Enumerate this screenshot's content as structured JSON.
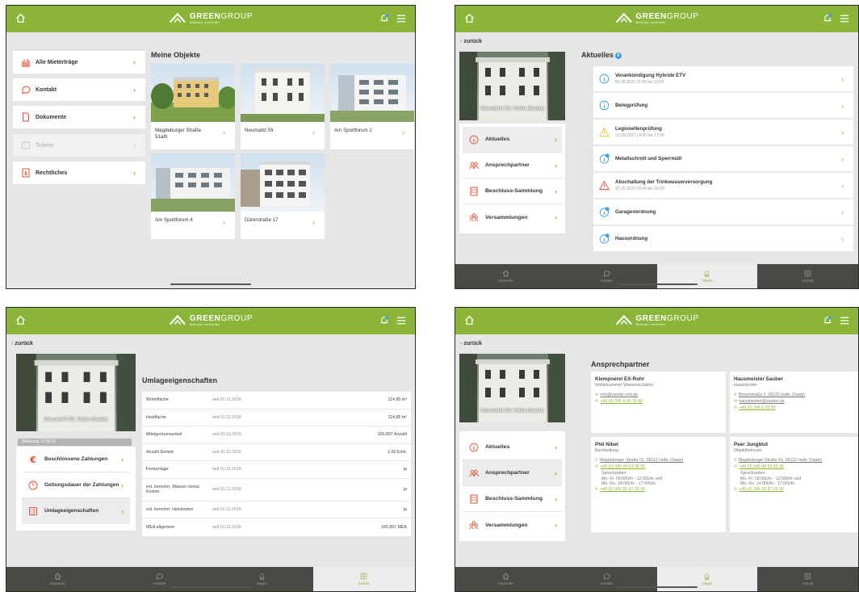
{
  "common": {
    "brand_bold": "GREEN",
    "brand_light": "GROUP",
    "brand_sub": "Wohnen verbindet",
    "back_label": "zurück",
    "location_caption": "Neumarkt 59, Halle (Saale)",
    "tabs": [
      "Startseite",
      "Kontakt",
      "Objekt",
      "Einheit"
    ]
  },
  "screen1": {
    "nav": [
      {
        "label": "Alle Mieterträge",
        "disabled": false
      },
      {
        "label": "Kontakt",
        "disabled": false
      },
      {
        "label": "Dokumente",
        "disabled": false
      },
      {
        "label": "Tickets",
        "disabled": true
      },
      {
        "label": "Rechtliches",
        "disabled": false
      }
    ],
    "objects_title": "Meine Objekte",
    "objects": [
      "Magdeburger Straße 51a/b",
      "Neumarkt 59",
      "Am Sportforum 2",
      "Am Sportforum 4",
      "Dürerstraße 17"
    ]
  },
  "screen2": {
    "news_title": "Aktuelles",
    "news_count": "6",
    "menu": [
      "Aktuelles",
      "Ansprechpartner",
      "Beschluss-Sammlung",
      "Versammlungen"
    ],
    "news": [
      {
        "title": "Vorankündigung Hybride ETV",
        "date": "06.08.2022 11:00 bis 13:00",
        "icon": "info-icon"
      },
      {
        "title": "Belegprüfung",
        "date": "",
        "icon": "info-icon"
      },
      {
        "title": "Legionellenprüfung",
        "date": "21.03.2022 14:00 bis 17:00",
        "icon": "warning-icon"
      },
      {
        "title": "Metallschrott und Sperrmüll",
        "date": "",
        "icon": "info-badge-icon"
      },
      {
        "title": "Abschaltung der Trinkwasserversorgung",
        "date": "15.02.2022 09:00 bis 16:00",
        "icon": "alert-icon"
      },
      {
        "title": "Garagenordnung",
        "date": "",
        "icon": "info-badge-icon"
      },
      {
        "title": "Hausordnung",
        "date": "",
        "icon": "info-badge-icon"
      }
    ]
  },
  "screen3": {
    "title": "Umlageeigenschaften",
    "unit_label": "Wohnung: ETW 01",
    "menu": [
      "Beschlossene Zahlungen",
      "Geltungsdauer der Zahlungen",
      "Umlageeigenschaften"
    ],
    "rows": [
      {
        "name": "Wohnfläche",
        "since": "seit 01.11.2016",
        "value": "114,85 m²"
      },
      {
        "name": "Heizfläche",
        "since": "seit 01.11.2016",
        "value": "114,85 m²"
      },
      {
        "name": "Miteigentumsanteil",
        "since": "seit 01.11.2016",
        "value": "165,897 Anzahl"
      },
      {
        "name": "Anzahl Einheit",
        "since": "seit 01.11.2016",
        "value": "1,00 Einh."
      },
      {
        "name": "Festumlage",
        "since": "seit 01.11.2016",
        "value": "ja"
      },
      {
        "name": "ext. berechn. Wasser-/sonst. Kosten",
        "since": "seit 01.11.2016",
        "value": "ja"
      },
      {
        "name": "ext. berechn. Heizkosten",
        "since": "seit 01.11.2016",
        "value": "ja"
      },
      {
        "name": "MEA allgemein",
        "since": "seit 01.11.2016",
        "value": "165,897 MEA"
      }
    ]
  },
  "screen4": {
    "title": "Ansprechpartner",
    "menu": [
      "Aktuelles",
      "Ansprechpartner",
      "Beschluss-Sammlung",
      "Versammlungen"
    ],
    "contacts": [
      {
        "name": "Klempnerei EX-Rohr",
        "role": "Notfallnummer Wasserschäden",
        "address": "",
        "email": "info@sanitär-rohr.de",
        "phone": "+49 (0) 345 4 45 39 80",
        "hours": "",
        "phone2": ""
      },
      {
        "name": "Hausmeister Sauber",
        "role": "Hausmeister",
        "address": "Besenstraße 2, 06132 Halle (Saale)",
        "email": "hausmeister@sauber.de",
        "phone": "+49 (0) 345 6 59 82",
        "hours": "",
        "phone2": ""
      },
      {
        "name": "Phil Nibel",
        "role": "Buchhaltung",
        "address": "Magdeburger Straße 51, 06112 Halle (Saale)",
        "email": "",
        "phone": "+49 (0) 345 44 53 98 30",
        "hours": "Sprechzeiten:\nMo.-Fr. 09:00Uhr - 12:00Uhr und\nMo.-Do. 14:00Uhr - 17:00Uhr",
        "phone2": "+49 (0) 345 55 87 26 56"
      },
      {
        "name": "Peer Jungblut",
        "role": "Objektbetreuer",
        "address": "Magdeburger Straße 51, 06112 Halle (Saale)",
        "email": "",
        "phone": "+49 (0) 345 44 53 98 30",
        "hours": "Sprechzeiten:\nMo.-Fr. 09:00Uhr - 12:00Uhr und\nMo.-Do. 14:00Uhr - 17:00Uhr",
        "phone2": "+49 (0) 345 55 87 26 56"
      }
    ]
  },
  "colors": {
    "brand_green": "#8ab539",
    "accent_red": "#e44c2e",
    "tabbar": "#4a4a44",
    "info_blue": "#3a9ee8",
    "warning_yellow": "#f1c232"
  }
}
